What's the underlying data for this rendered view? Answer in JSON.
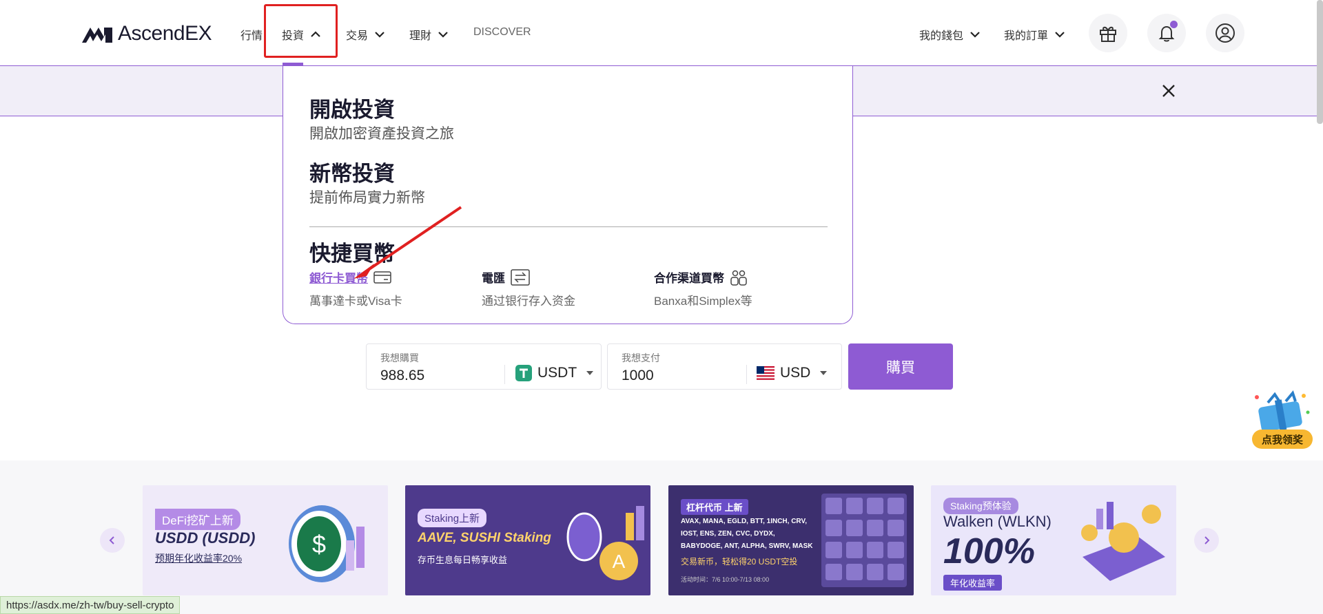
{
  "brand": {
    "name": "AscendEX",
    "accent": "#8e5bd3"
  },
  "nav": {
    "items": [
      {
        "label": "行情",
        "has_chevron": false
      },
      {
        "label": "投資",
        "has_chevron": true,
        "open": true
      },
      {
        "label": "交易",
        "has_chevron": true
      },
      {
        "label": "理財",
        "has_chevron": true
      },
      {
        "label": "DISCOVER",
        "has_chevron": false
      }
    ],
    "wallet": "我的錢包",
    "orders": "我的訂單"
  },
  "dropdown": {
    "sections": [
      {
        "title": "開啟投資",
        "subtitle": "開啟加密資產投資之旅"
      },
      {
        "title": "新幣投資",
        "subtitle": "提前佈局實力新幣"
      }
    ],
    "quick_title": "快捷買幣",
    "quick_items": [
      {
        "name": "銀行卡買幣",
        "desc": "萬事達卡或Visa卡",
        "icon": "credit-card-icon"
      },
      {
        "name": "電匯",
        "desc": "通过银行存入资金",
        "icon": "transfer-icon"
      },
      {
        "name": "合作渠道買幣",
        "desc": "Banxa和Simplex等",
        "icon": "partners-icon"
      }
    ]
  },
  "buy_form": {
    "want_buy_label": "我想購買",
    "want_buy_value": "988.65",
    "buy_coin": "USDT",
    "want_pay_label": "我想支付",
    "want_pay_value": "1000",
    "pay_currency": "USD",
    "buy_button": "購買"
  },
  "gift_float": {
    "label": "点我领奖"
  },
  "cards": [
    {
      "tag": "DeFi挖矿上新",
      "title": "USDD (USDD)",
      "subtitle": "预期年化收益率20%",
      "bg": "#efeaf9"
    },
    {
      "tag": "Staking上新",
      "title": "AAVE, SUSHI Staking",
      "subtitle": "存币生息每日畅享收益",
      "bg": "#4e3a8c"
    },
    {
      "tag": "杠杆代币 上新",
      "title": "AVAX, MANA, EGLD, BTT, 1INCH, CRV, IOST, ENS, ZEN, CVC, DYDX, BABYDOGE, ANT, ALPHA, SWRV, MASK",
      "subtitle": "交易新币，轻松得20 USDT空投",
      "note": "活动时间：7/6 10:00-7/13 08:00",
      "bg": "#3c2f6e"
    },
    {
      "tag": "Staking预体验",
      "title": "Walken (WLKN)",
      "subtitle": "100%",
      "note": "年化收益率",
      "bg": "#eae6fa"
    }
  ],
  "status_url": "https://asdx.me/zh-tw/buy-sell-crypto"
}
